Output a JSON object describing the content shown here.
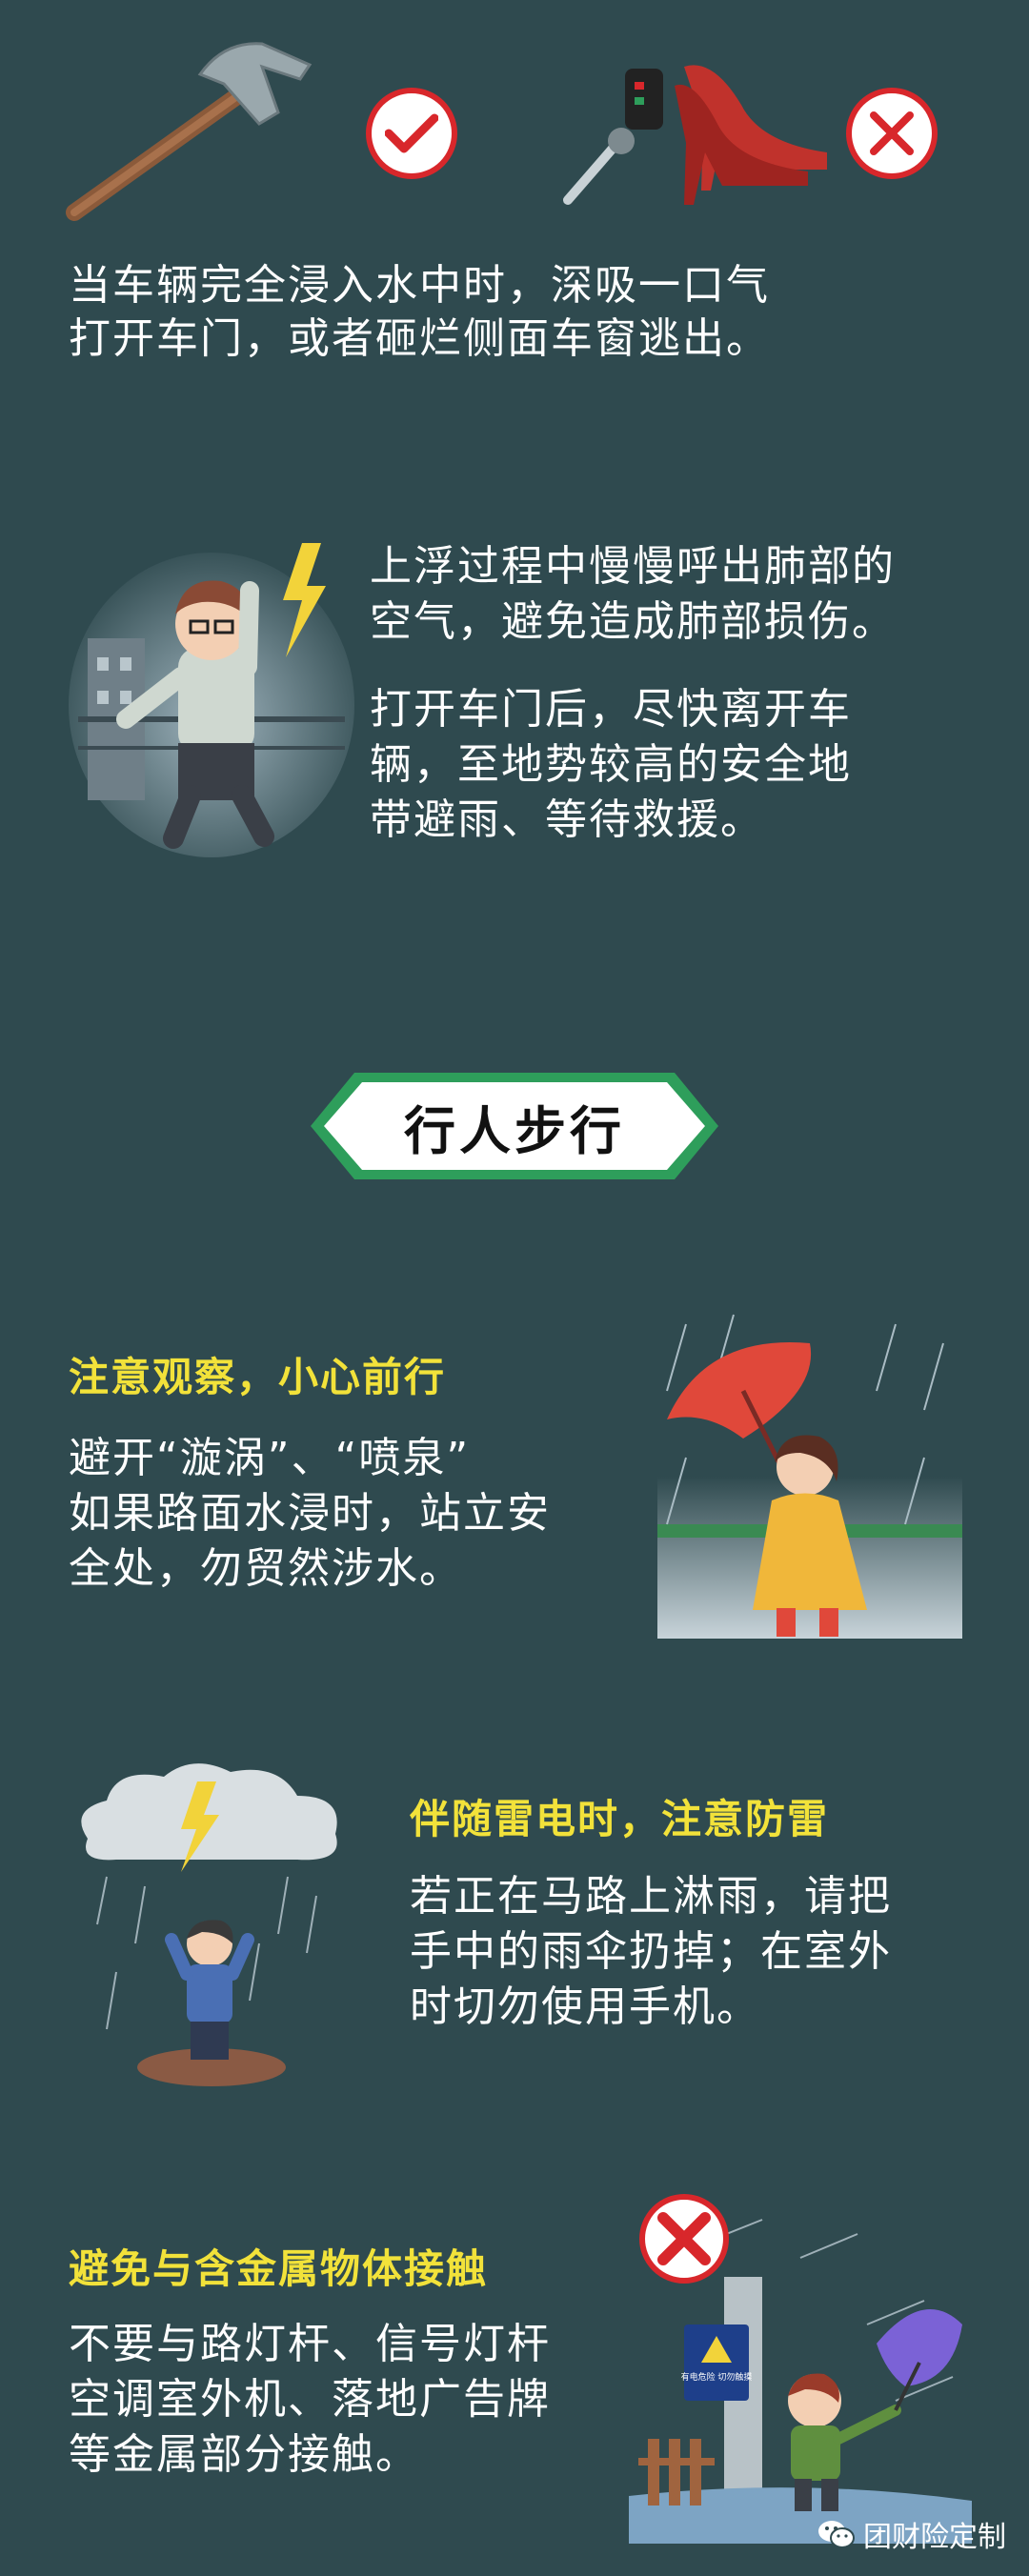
{
  "section1": {
    "text_line1": "当车辆完全浸入水中时，深吸一口气",
    "text_line2": "打开车门，或者砸烂侧面车窗逃出。"
  },
  "section2": {
    "para1_line1": "上浮过程中慢慢呼出肺部的",
    "para1_line2": "空气，避免造成肺部损伤。",
    "para2_line1": "打开车门后，尽快离开车",
    "para2_line2": "辆，至地势较高的安全地",
    "para2_line3": "带避雨、等待救援。"
  },
  "pill": {
    "label": "行人步行"
  },
  "section3": {
    "heading": "注意观察，小心前行",
    "line1": "避开“漩涡”、“喷泉”",
    "line2": "如果路面水浸时，站立安",
    "line3": "全处，勿贸然涉水。"
  },
  "section4": {
    "heading": "伴随雷电时，注意防雷",
    "line1": "若正在马路上淋雨，请把",
    "line2": "手中的雨伞扔掉；在室外",
    "line3": "时切勿使用手机。"
  },
  "section5": {
    "heading": "避免与含金属物体接触",
    "line1": "不要与路灯杆、信号灯杆",
    "line2": "空调室外机、落地广告牌",
    "line3": "等金属部分接触。",
    "sign_text": "有电危险 切勿触摸"
  },
  "watermark": {
    "text": "团财险定制"
  },
  "colors": {
    "background": "#2f4a4f",
    "heading": "#f2e23a",
    "badge_red": "#d8272b",
    "pill_border": "#2e9e5b"
  }
}
